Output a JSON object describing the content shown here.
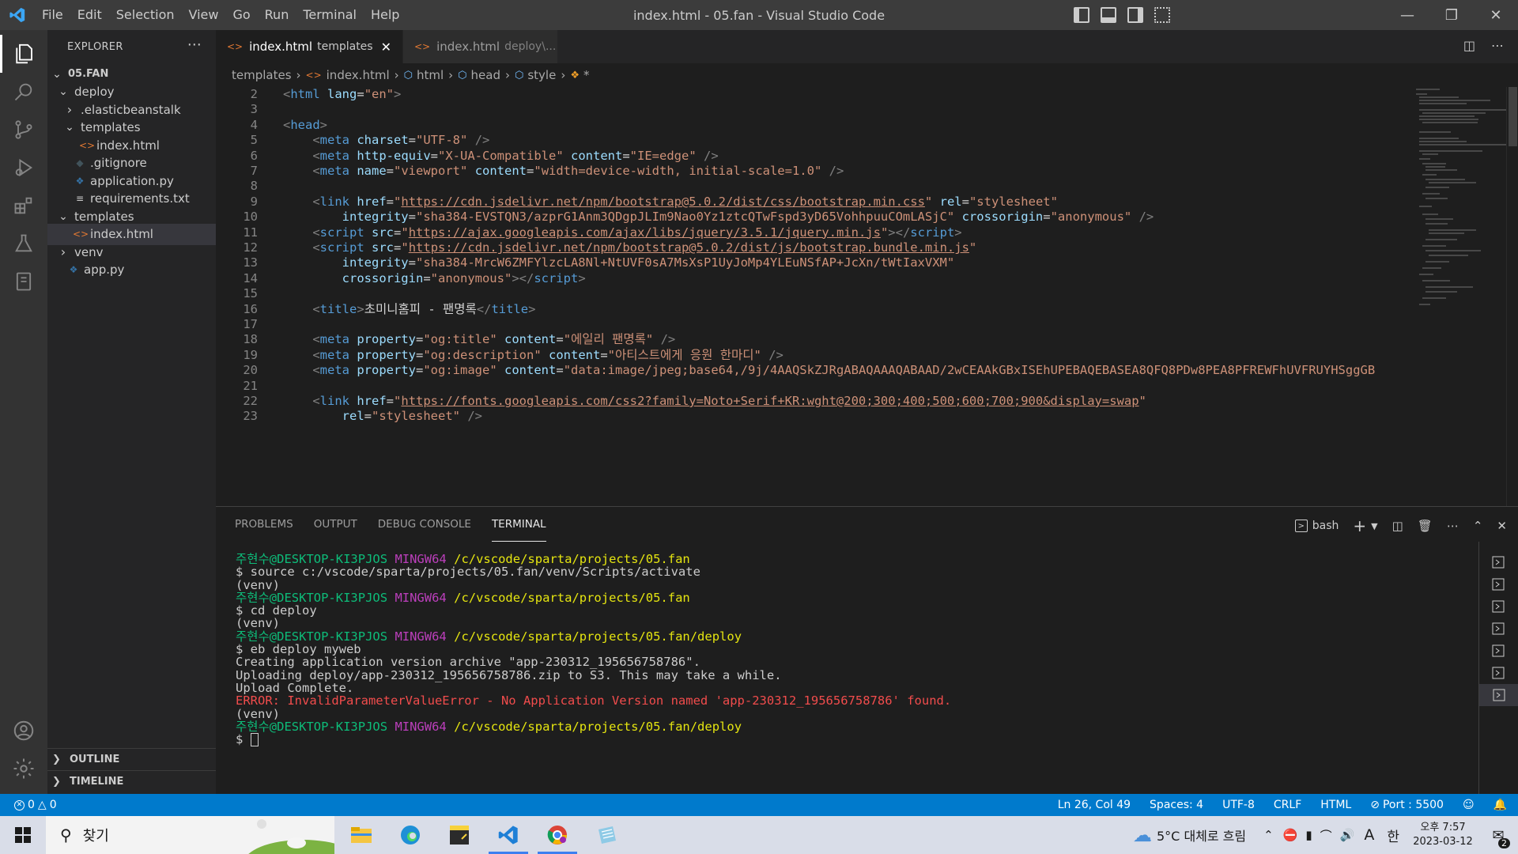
{
  "window": {
    "title": "index.html - 05.fan - Visual Studio Code",
    "menu": [
      "File",
      "Edit",
      "Selection",
      "View",
      "Go",
      "Run",
      "Terminal",
      "Help"
    ]
  },
  "sidebar": {
    "header": "EXPLORER",
    "tree": [
      {
        "label": "05.FAN",
        "depth": 0,
        "kind": "root",
        "open": true
      },
      {
        "label": "deploy",
        "depth": 1,
        "kind": "folder",
        "open": true
      },
      {
        "label": ".elasticbeanstalk",
        "depth": 2,
        "kind": "folder",
        "open": false
      },
      {
        "label": "templates",
        "depth": 2,
        "kind": "folder",
        "open": true
      },
      {
        "label": "index.html",
        "depth": 3,
        "kind": "html"
      },
      {
        "label": ".gitignore",
        "depth": 2,
        "kind": "git"
      },
      {
        "label": "application.py",
        "depth": 2,
        "kind": "python"
      },
      {
        "label": "requirements.txt",
        "depth": 2,
        "kind": "text"
      },
      {
        "label": "templates",
        "depth": 1,
        "kind": "folder",
        "open": true
      },
      {
        "label": "index.html",
        "depth": 2,
        "kind": "html",
        "selected": true
      },
      {
        "label": "venv",
        "depth": 1,
        "kind": "folder",
        "open": false
      },
      {
        "label": "app.py",
        "depth": 1,
        "kind": "python"
      }
    ],
    "outline": "OUTLINE",
    "timeline": "TIMELINE"
  },
  "tabs": [
    {
      "label": "index.html",
      "desc": "templates",
      "active": true
    },
    {
      "label": "index.html",
      "desc": "deploy\\...",
      "active": false
    }
  ],
  "breadcrumb": [
    "templates",
    "index.html",
    "html",
    "head",
    "style",
    "*"
  ],
  "code": [
    {
      "n": "2",
      "html": "<span class='t'>&lt;</span><span class='tn'>html</span> <span class='an'>lang</span><span class='tx'>=</span><span class='av'>\"en\"</span><span class='t'>&gt;</span>"
    },
    {
      "n": "3",
      "html": ""
    },
    {
      "n": "4",
      "html": "<span class='t'>&lt;</span><span class='tn'>head</span><span class='t'>&gt;</span>"
    },
    {
      "n": "5",
      "html": "    <span class='t'>&lt;</span><span class='tn'>meta</span> <span class='an'>charset</span><span class='tx'>=</span><span class='av'>\"UTF-8\"</span> <span class='t'>/&gt;</span>"
    },
    {
      "n": "6",
      "html": "    <span class='t'>&lt;</span><span class='tn'>meta</span> <span class='an'>http-equiv</span><span class='tx'>=</span><span class='av'>\"X-UA-Compatible\"</span> <span class='an'>content</span><span class='tx'>=</span><span class='av'>\"IE=edge\"</span> <span class='t'>/&gt;</span>"
    },
    {
      "n": "7",
      "html": "    <span class='t'>&lt;</span><span class='tn'>meta</span> <span class='an'>name</span><span class='tx'>=</span><span class='av'>\"viewport\"</span> <span class='an'>content</span><span class='tx'>=</span><span class='av'>\"width=device-width, initial-scale=1.0\"</span> <span class='t'>/&gt;</span>"
    },
    {
      "n": "8",
      "html": ""
    },
    {
      "n": "9",
      "html": "    <span class='t'>&lt;</span><span class='tn'>link</span> <span class='an'>href</span><span class='tx'>=</span><span class='av'>\"<span class='ul'>https://cdn.jsdelivr.net/npm/bootstrap@5.0.2/dist/css/bootstrap.min.css</span>\"</span> <span class='an'>rel</span><span class='tx'>=</span><span class='av'>\"stylesheet\"</span>"
    },
    {
      "n": "10",
      "html": "        <span class='an'>integrity</span><span class='tx'>=</span><span class='av'>\"sha384-EVSTQN3/azprG1Anm3QDgpJLIm9Nao0Yz1ztcQTwFspd3yD65VohhpuuCOmLASjC\"</span> <span class='an'>crossorigin</span><span class='tx'>=</span><span class='av'>\"anonymous\"</span> <span class='t'>/&gt;</span>"
    },
    {
      "n": "11",
      "html": "    <span class='t'>&lt;</span><span class='tn'>script</span> <span class='an'>src</span><span class='tx'>=</span><span class='av'>\"<span class='ul'>https://ajax.googleapis.com/ajax/libs/jquery/3.5.1/jquery.min.js</span>\"</span><span class='t'>&gt;&lt;/</span><span class='tn'>script</span><span class='t'>&gt;</span>"
    },
    {
      "n": "12",
      "html": "    <span class='t'>&lt;</span><span class='tn'>script</span> <span class='an'>src</span><span class='tx'>=</span><span class='av'>\"<span class='ul'>https://cdn.jsdelivr.net/npm/bootstrap@5.0.2/dist/js/bootstrap.bundle.min.js</span>\"</span>"
    },
    {
      "n": "13",
      "html": "        <span class='an'>integrity</span><span class='tx'>=</span><span class='av'>\"sha384-MrcW6ZMFYlzcLA8Nl+NtUVF0sA7MsXsP1UyJoMp4YLEuNSfAP+JcXn/tWtIaxVXM\"</span>"
    },
    {
      "n": "14",
      "html": "        <span class='an'>crossorigin</span><span class='tx'>=</span><span class='av'>\"anonymous\"</span><span class='t'>&gt;&lt;/</span><span class='tn'>script</span><span class='t'>&gt;</span>"
    },
    {
      "n": "15",
      "html": ""
    },
    {
      "n": "16",
      "html": "    <span class='t'>&lt;</span><span class='tn'>title</span><span class='t'>&gt;</span><span class='tx'>초미니홈피 - 팬명록</span><span class='t'>&lt;/</span><span class='tn'>title</span><span class='t'>&gt;</span>"
    },
    {
      "n": "17",
      "html": ""
    },
    {
      "n": "18",
      "html": "    <span class='t'>&lt;</span><span class='tn'>meta</span> <span class='an'>property</span><span class='tx'>=</span><span class='av'>\"og:title\"</span> <span class='an'>content</span><span class='tx'>=</span><span class='av'>\"에일리 팬명록\"</span> <span class='t'>/&gt;</span>"
    },
    {
      "n": "19",
      "html": "    <span class='t'>&lt;</span><span class='tn'>meta</span> <span class='an'>property</span><span class='tx'>=</span><span class='av'>\"og:description\"</span> <span class='an'>content</span><span class='tx'>=</span><span class='av'>\"아티스트에게 응원 한마디\"</span> <span class='t'>/&gt;</span>"
    },
    {
      "n": "20",
      "html": "    <span class='t'>&lt;</span><span class='tn'>meta</span> <span class='an'>property</span><span class='tx'>=</span><span class='av'>\"og:image\"</span> <span class='an'>content</span><span class='tx'>=</span><span class='av'>\"data:image/jpeg;base64,/9j/4AAQSkZJRgABAQAAAQABAAD/2wCEAAkGBxISEhUPEBAQEBASEA8QFQ8PDw8PEA8PFREWFhUVFRUYHSggGB</span>"
    },
    {
      "n": "21",
      "html": ""
    },
    {
      "n": "22",
      "html": "    <span class='t'>&lt;</span><span class='tn'>link</span> <span class='an'>href</span><span class='tx'>=</span><span class='av'>\"<span class='ul'>https://fonts.googleapis.com/css2?family=Noto+Serif+KR:wght@200;300;400;500;600;700;900&amp;display=swap</span>\"</span>"
    },
    {
      "n": "23",
      "html": "        <span class='an'>rel</span><span class='tx'>=</span><span class='av'>\"stylesheet\"</span> <span class='t'>/&gt;</span>"
    }
  ],
  "panel": {
    "tabs": [
      "PROBLEMS",
      "OUTPUT",
      "DEBUG CONSOLE",
      "TERMINAL"
    ],
    "active_tab": "TERMINAL",
    "shell": "bash",
    "terminal": [
      {
        "html": "<span class='g'>주현수@DESKTOP-KI3PJOS</span> <span class='m'>MINGW64</span> <span class='y'>/c/vscode/sparta/projects/05.fan</span>"
      },
      {
        "html": "<span class='w'>$ source c:/vscode/sparta/projects/05.fan/venv/Scripts/activate</span>"
      },
      {
        "html": "<span class='w'>(venv)</span>"
      },
      {
        "html": "<span class='g'>주현수@DESKTOP-KI3PJOS</span> <span class='m'>MINGW64</span> <span class='y'>/c/vscode/sparta/projects/05.fan</span>"
      },
      {
        "html": "<span class='w'>$ cd deploy</span>"
      },
      {
        "html": "<span class='w'>(venv)</span>"
      },
      {
        "html": "<span class='g'>주현수@DESKTOP-KI3PJOS</span> <span class='m'>MINGW64</span> <span class='y'>/c/vscode/sparta/projects/05.fan/deploy</span>"
      },
      {
        "html": "<span class='w'>$ eb deploy myweb</span>"
      },
      {
        "html": "<span class='w'>Creating application version archive \"app-230312_195656758786\".</span>"
      },
      {
        "html": "<span class='w'>Uploading deploy/app-230312_195656758786.zip to S3. This may take a while.</span>"
      },
      {
        "html": "<span class='w'>Upload Complete.</span>"
      },
      {
        "html": "<span class='r'>ERROR: InvalidParameterValueError - No Application Version named 'app-230312_195656758786' found.</span>"
      },
      {
        "html": "<span class='w'>(venv)</span>"
      },
      {
        "html": "<span class='g'>주현수@DESKTOP-KI3PJOS</span> <span class='m'>MINGW64</span> <span class='y'>/c/vscode/sparta/projects/05.fan/deploy</span>"
      },
      {
        "html": "<span class='w'>$ </span><span class='cursor'></span>"
      }
    ]
  },
  "status": {
    "errors": "0",
    "warnings": "0",
    "position": "Ln 26, Col 49",
    "spaces": "Spaces: 4",
    "encoding": "UTF-8",
    "eol": "CRLF",
    "language": "HTML",
    "port": "Port : 5500"
  },
  "taskbar": {
    "search_placeholder": "찾기",
    "weather": "5°C  대체로 흐림",
    "ime_a": "A",
    "ime_lang": "한",
    "time": "오후 7:57",
    "date": "2023-03-12",
    "notifications": "2"
  },
  "colors": {
    "accent": "#007acc",
    "activity_bar": "#333333",
    "sidebar": "#252526",
    "editor": "#1e1e1e",
    "titlebar": "#3c3c3c",
    "terminal_error": "#f14c4c"
  }
}
